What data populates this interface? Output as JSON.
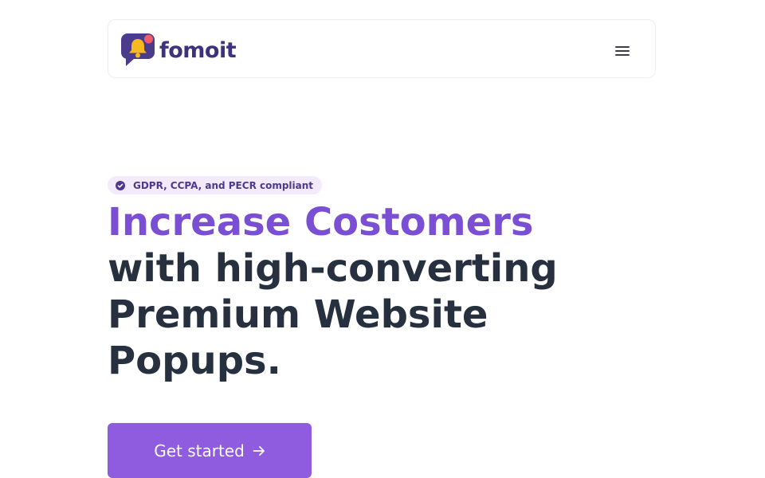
{
  "brand": {
    "name": "fomoit",
    "logo_icon": "bell-chat-icon",
    "color_primary": "#7b4fd3",
    "color_dark": "#3e3280"
  },
  "nav": {
    "menu_icon": "hamburger-menu-icon"
  },
  "hero": {
    "badge_icon": "check-badge-icon",
    "badge_text": "GDPR, CCPA, and PECR compliant",
    "headline_accent": "Increase Costomers",
    "headline_rest": "with high-converting Premium Website Popups.",
    "cta_label": "Get started",
    "cta_icon": "arrow-right-icon",
    "cta_color": "#8f5ce0"
  }
}
